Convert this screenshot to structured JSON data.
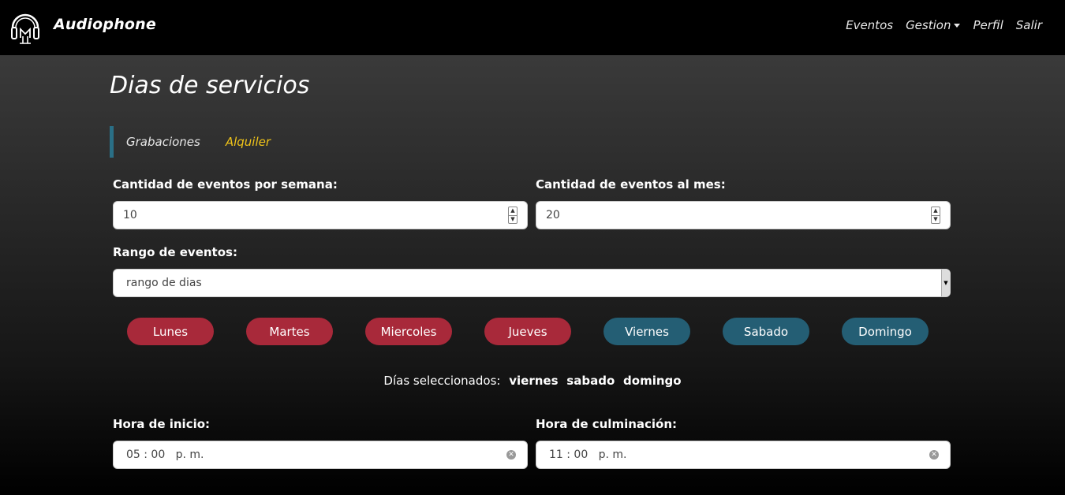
{
  "navbar": {
    "brand": "Audiophone",
    "links": [
      "Eventos",
      "Gestion",
      "Perfil",
      "Salir"
    ]
  },
  "page": {
    "title": "Dias de servicios"
  },
  "tabs": {
    "active": "Grabaciones",
    "other": "Alquiler"
  },
  "form": {
    "per_week_label": "Cantidad de eventos por semana:",
    "per_week_value": "10",
    "per_month_label": "Cantidad de eventos al mes:",
    "per_month_value": "20",
    "range_label": "Rango de eventos:",
    "range_value": "rango de dias",
    "start_label": "Hora de inicio:",
    "start_value": "05 : 00   p. m.",
    "end_label": "Hora de culminación:",
    "end_value": "11 : 00   p. m."
  },
  "days": [
    {
      "label": "Lunes",
      "selected": false
    },
    {
      "label": "Martes",
      "selected": false
    },
    {
      "label": "Miercoles",
      "selected": false
    },
    {
      "label": "Jueves",
      "selected": false
    },
    {
      "label": "Viernes",
      "selected": true
    },
    {
      "label": "Sabado",
      "selected": true
    },
    {
      "label": "Domingo",
      "selected": true
    }
  ],
  "selection": {
    "prefix": "Días seleccionados:",
    "items": [
      "viernes",
      "sabado",
      "domingo"
    ]
  },
  "colors": {
    "unselected_day": "#a8293a",
    "selected_day": "#245e74",
    "tab_accent": "#2a6f86",
    "link_yellow": "#f0c419"
  }
}
